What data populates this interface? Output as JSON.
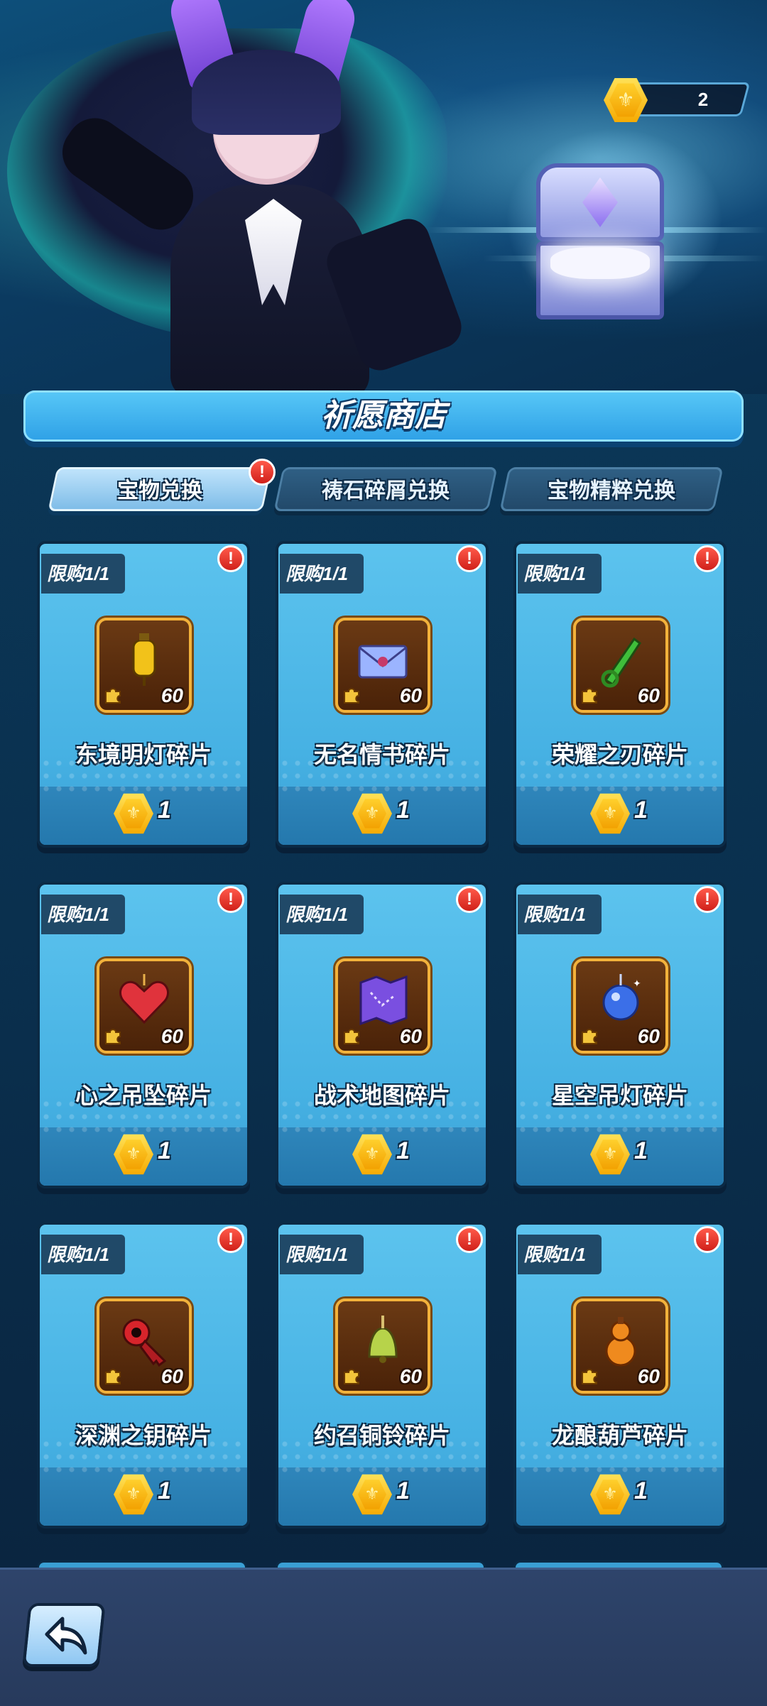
{
  "currency": {
    "amount": "2",
    "icon": "hex-coin-icon"
  },
  "shop": {
    "title": "祈愿商店"
  },
  "tabs": [
    {
      "label": "宝物兑换",
      "active": true,
      "has_badge": true
    },
    {
      "label": "祷石碎屑兑换",
      "active": false,
      "has_badge": false
    },
    {
      "label": "宝物精粹兑换",
      "active": false,
      "has_badge": false
    }
  ],
  "badge_symbol": "!",
  "items": [
    {
      "limit": "限购1/1",
      "name": "东境明灯碎片",
      "count": "60",
      "price": "1",
      "icon": "lantern-icon",
      "color": "#f2c21a"
    },
    {
      "limit": "限购1/1",
      "name": "无名情书碎片",
      "count": "60",
      "price": "1",
      "icon": "letter-icon",
      "color": "#9bb4ff"
    },
    {
      "limit": "限购1/1",
      "name": "荣耀之刃碎片",
      "count": "60",
      "price": "1",
      "icon": "blade-icon",
      "color": "#3fbf3a"
    },
    {
      "limit": "限购1/1",
      "name": "心之吊坠碎片",
      "count": "60",
      "price": "1",
      "icon": "heart-pendant-icon",
      "color": "#e0333c"
    },
    {
      "limit": "限购1/1",
      "name": "战术地图碎片",
      "count": "60",
      "price": "1",
      "icon": "map-icon",
      "color": "#7a4fe0"
    },
    {
      "limit": "限购1/1",
      "name": "星空吊灯碎片",
      "count": "60",
      "price": "1",
      "icon": "star-lamp-icon",
      "color": "#3b6fe8"
    },
    {
      "limit": "限购1/1",
      "name": "深渊之钥碎片",
      "count": "60",
      "price": "1",
      "icon": "key-icon",
      "color": "#d8242b"
    },
    {
      "limit": "限购1/1",
      "name": "约召铜铃碎片",
      "count": "60",
      "price": "1",
      "icon": "bell-icon",
      "color": "#b7d34a"
    },
    {
      "limit": "限购1/1",
      "name": "龙酿葫芦碎片",
      "count": "60",
      "price": "1",
      "icon": "gourd-icon",
      "color": "#ef8a1e"
    }
  ]
}
